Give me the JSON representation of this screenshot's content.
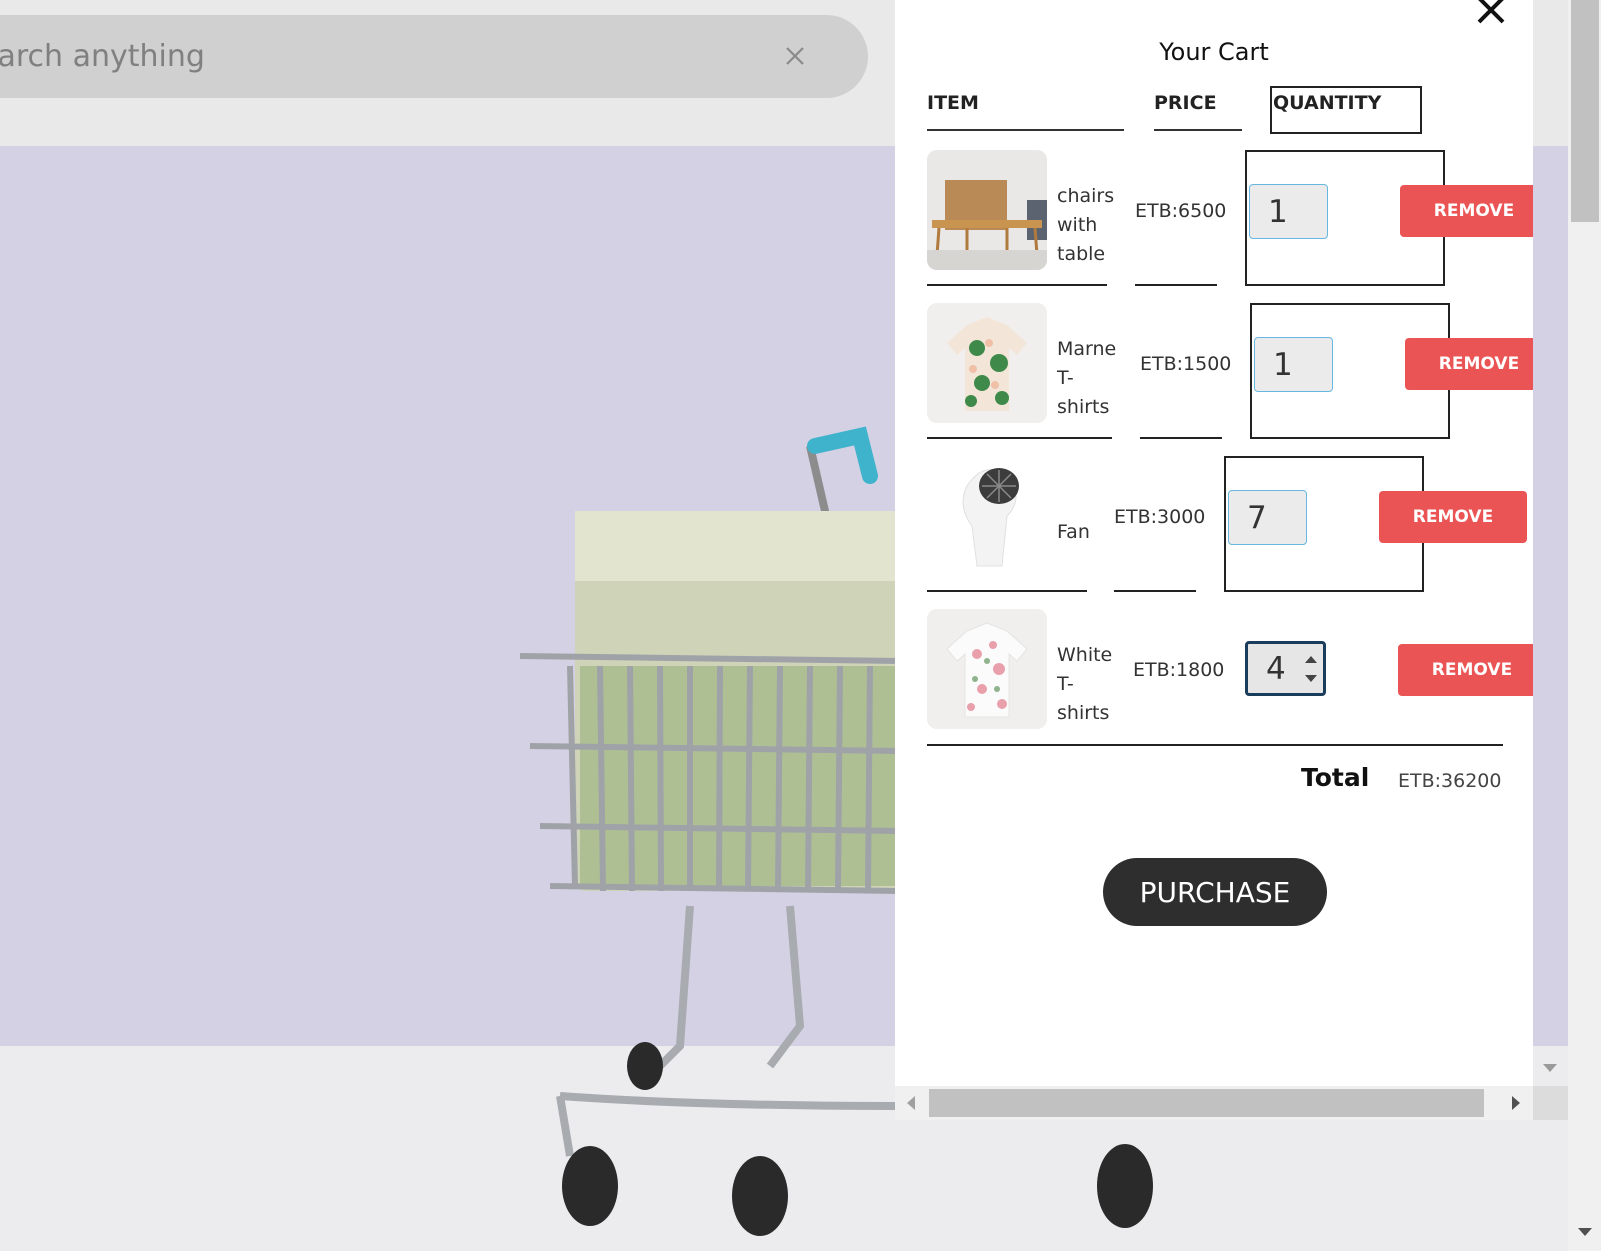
{
  "search": {
    "value": "",
    "placeholder": "Search anything"
  },
  "cart": {
    "title": "Your Cart",
    "columns": {
      "item": "ITEM",
      "price": "PRICE",
      "quantity": "QUANTITY"
    },
    "items": [
      {
        "name": "chairs with table",
        "price": "ETB:6500",
        "quantity": "1",
        "remove_label": "REMOVE",
        "image": "dining-table-image"
      },
      {
        "name": "Marne T-shirts",
        "price": "ETB:1500",
        "quantity": "1",
        "remove_label": "REMOVE",
        "image": "floral-shirt-image"
      },
      {
        "name": "Fan",
        "price": "ETB:3000",
        "quantity": "7",
        "remove_label": "REMOVE",
        "image": "white-fan-image"
      },
      {
        "name": "White T-shirts",
        "price": "ETB:1800",
        "quantity": "4",
        "remove_label": "REMOVE",
        "image": "white-floral-shirt-image"
      }
    ],
    "total_label": "Total",
    "total_value": "ETB:36200",
    "purchase_label": "PURCHASE"
  },
  "colors": {
    "remove": "#eb5454",
    "purchase": "#2e2e2e",
    "hero_background": "#d4d1e4"
  },
  "icons": [
    "close-icon",
    "search-clear-icon",
    "spinner-up-icon",
    "spinner-down-icon",
    "scroll-left-icon",
    "scroll-right-icon",
    "scroll-down-icon"
  ]
}
